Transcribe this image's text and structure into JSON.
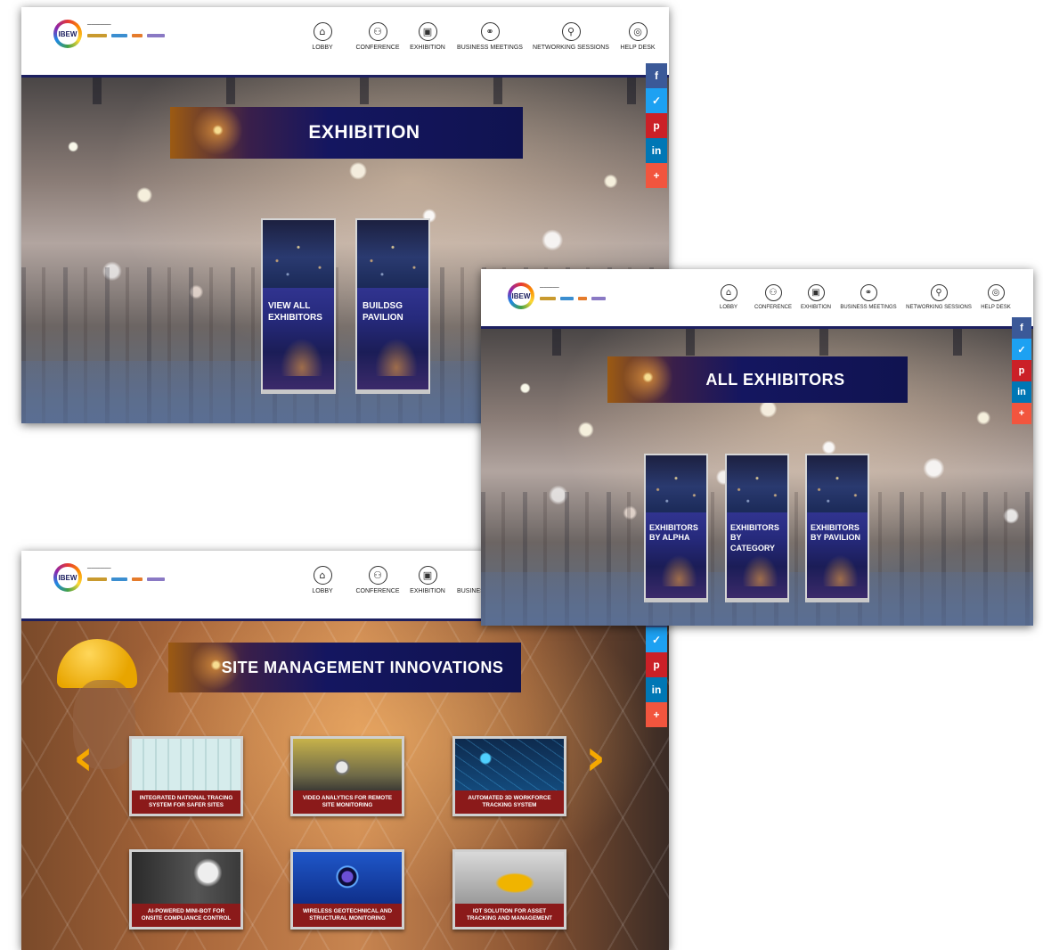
{
  "logo": {
    "text": "IBEW"
  },
  "nav": [
    {
      "label": "LOBBY",
      "icon": "lobby-icon",
      "glyph": "⌂"
    },
    {
      "label": "CONFERENCE",
      "icon": "conference-icon",
      "glyph": "⚇"
    },
    {
      "label": "EXHIBITION",
      "icon": "exhibition-icon",
      "glyph": "▣"
    },
    {
      "label": "BUSINESS MEETINGS",
      "icon": "business-meetings-icon",
      "glyph": "⚭"
    },
    {
      "label": "NETWORKING SESSIONS",
      "icon": "networking-sessions-icon",
      "glyph": "⚲"
    },
    {
      "label": "HELP DESK",
      "icon": "help-desk-icon",
      "glyph": "◎"
    }
  ],
  "social": [
    {
      "glyph": "f",
      "icon": "facebook-icon",
      "color": "#3b5998"
    },
    {
      "glyph": "✓",
      "icon": "twitter-icon",
      "color": "#1da1f2"
    },
    {
      "glyph": "p",
      "icon": "pinterest-icon",
      "color": "#cb2027"
    },
    {
      "glyph": "in",
      "icon": "linkedin-icon",
      "color": "#0077b5"
    },
    {
      "glyph": "+",
      "icon": "share-more-icon",
      "color": "#f2553e"
    }
  ],
  "exhibition": {
    "title": "EXHIBITION",
    "kiosks": [
      {
        "line1": "VIEW ALL",
        "line2": "EXHIBITORS"
      },
      {
        "line1": "BUILDSG",
        "line2": "PAVILION"
      }
    ]
  },
  "all_exhibitors": {
    "title": "ALL EXHIBITORS",
    "kiosks": [
      {
        "line1": "EXHIBITORS",
        "line2": "BY ALPHA"
      },
      {
        "line1": "EXHIBITORS",
        "line2": "BY CATEGORY"
      },
      {
        "line1": "EXHIBITORS",
        "line2": "BY PAVILION"
      }
    ]
  },
  "site_management": {
    "title": "SITE MANAGEMENT INNOVATIONS",
    "prev_glyph": "‹",
    "next_glyph": "›",
    "cards": [
      {
        "line1": "INTEGRATED NATIONAL TRACING",
        "line2": "SYSTEM FOR SAFER SITES"
      },
      {
        "line1": "VIDEO ANALYTICS FOR REMOTE",
        "line2": "SITE MONITORING"
      },
      {
        "line1": "AUTOMATED 3D WORKFORCE",
        "line2": "TRACKING SYSTEM"
      },
      {
        "line1": "AI-POWERED MINI-BOT FOR",
        "line2": "ONSITE COMPLIANCE CONTROL"
      },
      {
        "line1": "WIRELESS GEOTECHNICAL AND",
        "line2": "STRUCTURAL MONITORING"
      },
      {
        "line1": "IOT SOLUTION FOR ASSET",
        "line2": "TRACKING AND MANAGEMENT"
      }
    ]
  }
}
